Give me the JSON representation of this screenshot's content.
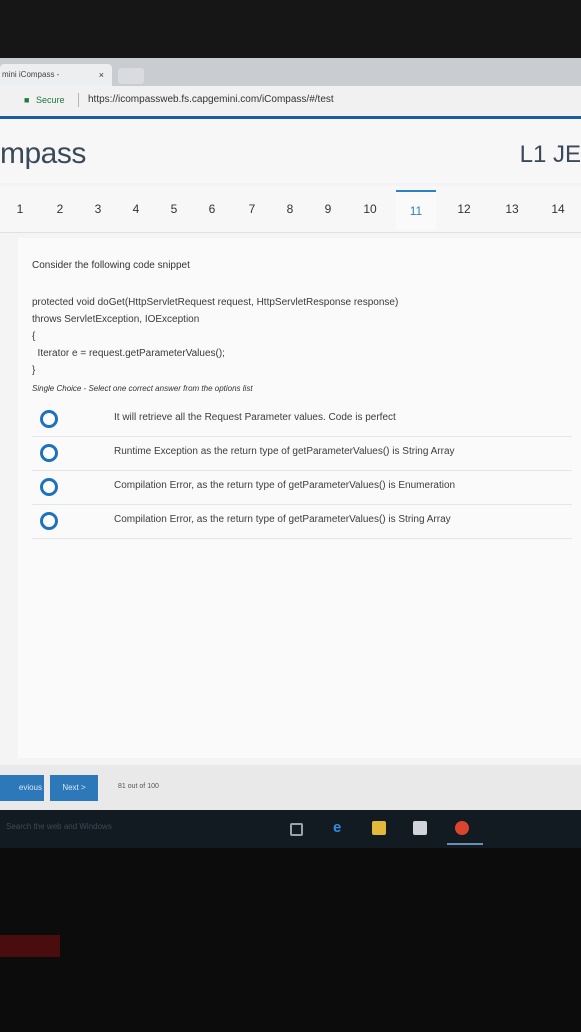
{
  "browser": {
    "tab_title": "mini iCompass - ",
    "tab_close": "×",
    "secure_label": "Secure",
    "url": "https://icompassweb.fs.capgemini.com/iCompass/#/test"
  },
  "app": {
    "brand": "mpass",
    "course": "L1 JE"
  },
  "question_nav": {
    "numbers": [
      "1",
      "2",
      "3",
      "4",
      "5",
      "6",
      "7",
      "8",
      "9",
      "10",
      "11",
      "12",
      "13",
      "14"
    ],
    "active": "11"
  },
  "question": {
    "prompt": "Consider the following code snippet",
    "code": [
      "protected void doGet(HttpServletRequest request, HttpServletResponse response)",
      "throws ServletException, IOException",
      "{",
      "  Iterator e = request.getParameterValues();",
      "}"
    ],
    "hint": "Single Choice - Select one correct answer from the options list",
    "options": [
      "It will retrieve all the Request Parameter values. Code is perfect",
      "Runtime Exception  as the return type of getParameterValues() is String Array",
      "Compilation Error, as the return type of getParameterValues() is Enumeration",
      "Compilation Error, as the return type of getParameterValues() is String Array"
    ]
  },
  "footer": {
    "prev_label": "evious",
    "next_label": "Next >",
    "progress": "81 out of 100"
  },
  "taskbar": {
    "search_placeholder": "Search the web and Windows",
    "icons": [
      "task-view-icon",
      "edge-icon",
      "file-explorer-icon",
      "store-icon",
      "chrome-icon"
    ]
  },
  "colors": {
    "accent": "#1a5c9e",
    "radio": "#1e72bd",
    "button": "#2c78b8"
  }
}
